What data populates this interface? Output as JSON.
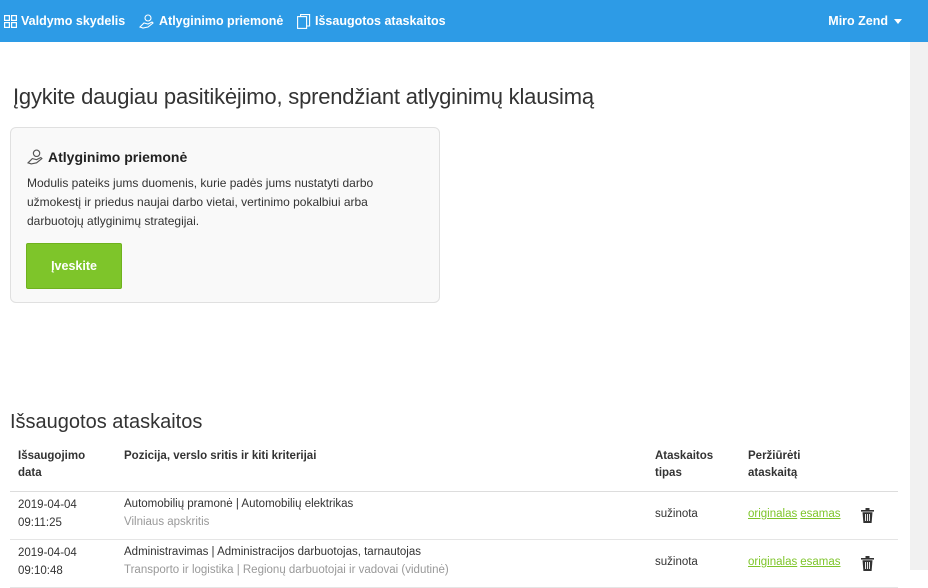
{
  "nav": {
    "dashboard": "Valdymo skydelis",
    "compensation_tool": "Atlyginimo priemonė",
    "saved_reports": "Išsaugotos ataskaitos",
    "user": "Miro Zend"
  },
  "hero": {
    "title": "Įgykite daugiau pasitikėjimo, sprendžiant atlyginimų klausimą"
  },
  "card": {
    "title": "Atlyginimo priemonė",
    "text": "Modulis pateiks jums duomenis, kurie padės jums nustatyti darbo užmokestį ir priedus naujai darbo vietai, vertinimo pokalbiui arba darbuotojų atlyginimų strategijai.",
    "button": "Įveskite"
  },
  "saved": {
    "title": "Išsaugotos ataskaitos",
    "headers": {
      "date": "Išsaugojimo data",
      "position": "Pozicija, verslo sritis ir kiti kriterijai",
      "type": "Ataskaitos tipas",
      "view": "Peržiūrėti ataskaitą"
    },
    "rows": [
      {
        "date": "2019-04-04",
        "time": "09:11:25",
        "position": "Automobilių pramonė | Automobilių elektrikas",
        "region": "Vilniaus apskritis",
        "type": "sužinota",
        "link1": "originalas",
        "link2": "esamas"
      },
      {
        "date": "2019-04-04",
        "time": "09:10:48",
        "position": "Administravimas | Administracijos darbuotojas, tarnautojas",
        "region": "Transporto ir logistika | Regionų darbuotojai ir vadovai (vidutinė)",
        "type": "sužinota",
        "link1": "originalas",
        "link2": "esamas"
      }
    ]
  },
  "colors": {
    "topbar": "#2d9be6",
    "accent_green": "#7ec52a"
  },
  "icons": {
    "dashboard": "grid-icon",
    "tool": "hand-coin-icon",
    "reports": "documents-icon",
    "delete": "trash-icon"
  }
}
